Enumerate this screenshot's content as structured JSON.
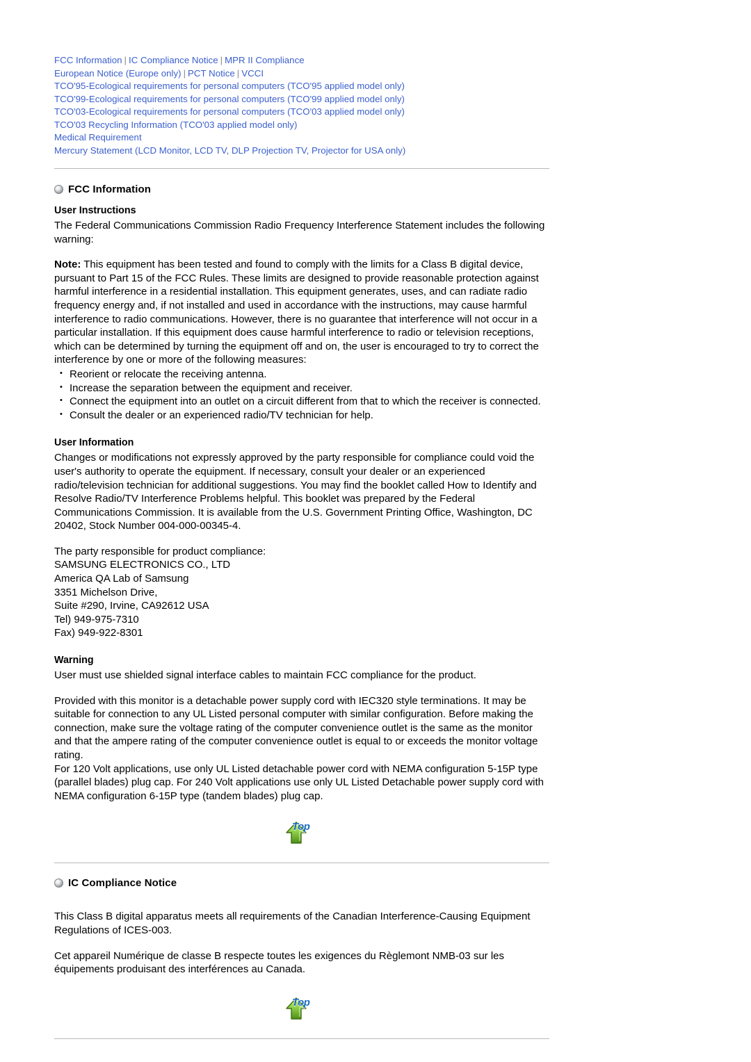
{
  "nav": {
    "rows": [
      [
        "FCC Information",
        "IC Compliance Notice",
        "MPR II Compliance"
      ],
      [
        "European Notice (Europe only)",
        "PCT Notice",
        "VCCI"
      ],
      [
        "TCO'95-Ecological requirements for personal computers (TCO'95 applied model only)"
      ],
      [
        "TCO'99-Ecological requirements for personal computers (TCO'99 applied model only)"
      ],
      [
        "TCO'03-Ecological requirements for personal computers (TCO'03 applied model only)"
      ],
      [
        "TCO'03 Recycling Information (TCO'03 applied model only)"
      ],
      [
        "Medical Requirement"
      ],
      [
        "Mercury Statement (LCD Monitor, LCD TV, DLP Projection TV, Projector for USA only)"
      ]
    ],
    "separator": "|"
  },
  "fcc": {
    "heading": "FCC Information",
    "user_instructions_heading": "User Instructions",
    "user_instructions_body": "The Federal Communications Commission Radio Frequency Interference Statement includes the following warning:",
    "note_label": "Note:",
    "note_body": " This equipment has been tested and found to comply with the limits for a Class B digital device, pursuant to Part 15 of the FCC Rules. These limits are designed to provide reasonable protection against harmful interference in a residential installation. This equipment generates, uses, and can radiate radio frequency energy and, if not installed and used in accordance with the instructions, may cause harmful interference to radio communications. However, there is no guarantee that interference will not occur in a particular installation. If this equipment does cause harmful interference to radio or television receptions, which can be determined by turning the equipment off and on, the user is encouraged to try to correct the interference by one or more of the following measures:",
    "measures": [
      "Reorient or relocate the receiving antenna.",
      "Increase the separation between the equipment and receiver.",
      "Connect the equipment into an outlet on a circuit different from that to which the receiver is connected.",
      "Consult the dealer or an experienced radio/TV technician for help."
    ],
    "user_information_heading": "User Information",
    "user_information_body": "Changes or modifications not expressly approved by the party responsible for compliance could void the user's authority to operate the equipment. If necessary, consult your dealer or an experienced radio/television technician for additional suggestions. You may find the booklet called How to Identify and Resolve Radio/TV Interference Problems helpful. This booklet was prepared by the Federal Communications Commission. It is available from the U.S. Government Printing Office, Washington, DC 20402, Stock Number 004-000-00345-4.",
    "responsible_party": [
      "The party responsible for product compliance:",
      "SAMSUNG ELECTRONICS CO., LTD",
      "America QA Lab of Samsung",
      "3351 Michelson Drive,",
      "Suite #290, Irvine, CA92612 USA",
      "Tel) 949-975-7310",
      "Fax) 949-922-8301"
    ],
    "warning_heading": "Warning",
    "warning_body": "User must use shielded signal interface cables to maintain FCC compliance for the product.",
    "warning_body2": "Provided with this monitor is a detachable power supply cord with IEC320 style terminations. It may be suitable for connection to any UL Listed personal computer with similar configuration. Before making the connection, make sure the voltage rating of the computer convenience outlet is the same as the monitor and that the ampere rating of the computer convenience outlet is equal to or exceeds the monitor voltage rating.",
    "warning_body3": "For 120 Volt applications, use only UL Listed detachable power cord with NEMA configuration 5-15P type (parallel blades) plug cap. For 240 Volt applications use only UL Listed Detachable power supply cord with NEMA configuration 6-15P type (tandem blades) plug cap."
  },
  "ic": {
    "heading": "IC Compliance Notice",
    "body1": "This Class B digital apparatus meets all requirements of the Canadian Interference-Causing Equipment Regulations of ICES-003.",
    "body2": "Cet appareil Numérique de classe B respecte toutes les exigences du Règlemont NMB-03 sur les équipements produisant des interférences au Canada."
  },
  "top_button": {
    "label": "Top",
    "icon": "up-arrow-icon"
  },
  "colors": {
    "link": "#3a5fcd",
    "rule": "#b8b8b8",
    "top_label": "#1b6ec2"
  }
}
